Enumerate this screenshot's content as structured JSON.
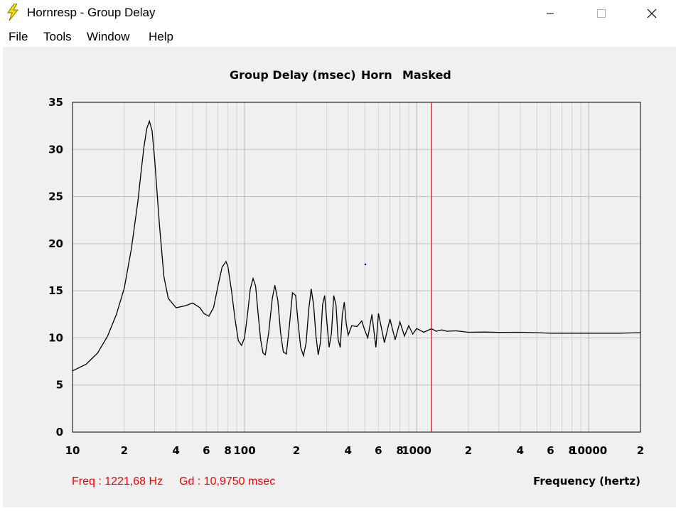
{
  "window": {
    "title": "Hornresp - Group Delay",
    "icon": "lightning-bolt-icon",
    "controls": [
      "minimize-icon",
      "maximize-icon",
      "close-icon"
    ]
  },
  "menu": {
    "items": [
      {
        "label": "File"
      },
      {
        "label": "Tools"
      },
      {
        "label": "Window"
      },
      {
        "label": "Help"
      }
    ]
  },
  "chart": {
    "title_parts": [
      "Group Delay (msec)",
      "Horn",
      "Masked"
    ],
    "y_ticks": [
      "35",
      "30",
      "25",
      "20",
      "15",
      "10",
      "5",
      "0"
    ],
    "x_ticks": [
      {
        "f": 10,
        "label": "10"
      },
      {
        "f": 20,
        "label": "2"
      },
      {
        "f": 40,
        "label": "4"
      },
      {
        "f": 60,
        "label": "6"
      },
      {
        "f": 80,
        "label": "8"
      },
      {
        "f": 100,
        "label": "100"
      },
      {
        "f": 200,
        "label": "2"
      },
      {
        "f": 400,
        "label": "4"
      },
      {
        "f": 600,
        "label": "6"
      },
      {
        "f": 800,
        "label": "8"
      },
      {
        "f": 1000,
        "label": "1000"
      },
      {
        "f": 2000,
        "label": "2"
      },
      {
        "f": 4000,
        "label": "4"
      },
      {
        "f": 6000,
        "label": "6"
      },
      {
        "f": 8000,
        "label": "8"
      },
      {
        "f": 10000,
        "label": "10000"
      },
      {
        "f": 20000,
        "label": "2"
      }
    ],
    "freq_readout": "Freq : 1221,68 Hz",
    "gd_readout": "Gd : 10,9750 msec",
    "x_axis_label": "Frequency (hertz)",
    "cursor_color": "#ff0000",
    "curve_color": "#000000",
    "grid_color": "#c0c0c0"
  },
  "chart_data": {
    "type": "line",
    "title": "Group Delay (msec)   Horn   Masked",
    "xlabel": "Frequency (hertz)",
    "ylabel": "",
    "x_scale": "log",
    "xlim": [
      10,
      20000
    ],
    "ylim": [
      0,
      35
    ],
    "grid": true,
    "cursor": {
      "x": 1221.68,
      "y": 10.975
    },
    "series": [
      {
        "x": [
          10,
          12,
          14,
          16,
          18,
          20,
          22,
          24,
          25,
          26,
          27,
          28,
          29,
          30,
          32,
          34,
          36,
          40,
          45,
          50,
          55,
          58,
          62,
          66,
          70,
          74,
          78,
          80,
          84,
          88,
          92,
          96,
          100,
          104,
          108,
          112,
          116,
          120,
          124,
          128,
          132,
          138,
          145,
          150,
          156,
          162,
          168,
          175,
          182,
          190,
          198,
          205,
          212,
          220,
          228,
          236,
          244,
          252,
          260,
          268,
          276,
          284,
          292,
          300,
          310,
          320,
          330,
          340,
          350,
          360,
          370,
          380,
          390,
          400,
          420,
          450,
          480,
          500,
          520,
          550,
          580,
          600,
          650,
          700,
          750,
          800,
          850,
          900,
          950,
          1000,
          1100,
          1221.68,
          1300,
          1400,
          1500,
          1700,
          2000,
          2500,
          3000,
          4000,
          5000,
          6000,
          8000,
          10000,
          15000,
          20000
        ],
        "values": [
          6.5,
          7.2,
          8.4,
          10.2,
          12.5,
          15.3,
          19.5,
          24.5,
          27.5,
          30.2,
          32.2,
          33.0,
          32.0,
          29.0,
          22.0,
          16.5,
          14.2,
          13.2,
          13.4,
          13.7,
          13.2,
          12.6,
          12.3,
          13.2,
          15.5,
          17.5,
          18.1,
          17.6,
          15.0,
          12.0,
          9.7,
          9.2,
          10.0,
          12.5,
          15.2,
          16.3,
          15.5,
          12.5,
          9.8,
          8.4,
          8.2,
          10.5,
          14.2,
          15.6,
          14.0,
          10.5,
          8.5,
          8.3,
          11.2,
          14.8,
          14.5,
          11.5,
          9.0,
          8.1,
          9.5,
          13.0,
          15.2,
          13.5,
          10.2,
          8.2,
          9.5,
          13.5,
          14.5,
          12.0,
          9.0,
          10.5,
          14.5,
          13.5,
          9.8,
          9.0,
          12.5,
          13.8,
          11.5,
          10.3,
          11.3,
          11.2,
          11.8,
          10.8,
          10.0,
          12.5,
          9.0,
          12.6,
          9.5,
          12.0,
          9.8,
          11.7,
          10.2,
          11.3,
          10.4,
          11.0,
          10.6,
          10.975,
          10.7,
          10.85,
          10.7,
          10.75,
          10.6,
          10.62,
          10.58,
          10.6,
          10.55,
          10.5,
          10.5,
          10.5,
          10.5,
          10.55
        ]
      }
    ]
  }
}
